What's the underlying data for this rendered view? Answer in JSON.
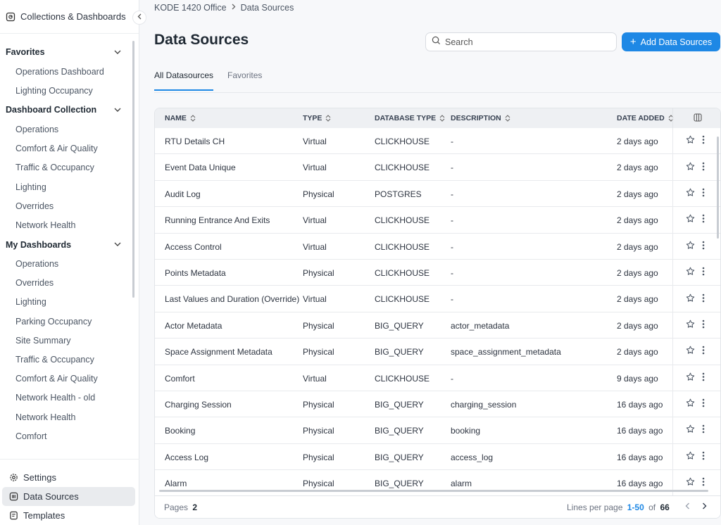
{
  "sidebar": {
    "top_label": "Collections & Dashboards",
    "favorites": {
      "title": "Favorites",
      "items": [
        "Operations Dashboard",
        "Lighting Occupancy"
      ]
    },
    "dashboard_collection": {
      "title": "Dashboard Collection",
      "items": [
        "Operations",
        "Comfort & Air Quality",
        "Traffic & Occupancy",
        "Lighting",
        "Overrides",
        "Network Health"
      ]
    },
    "my_dashboards": {
      "title": "My Dashboards",
      "items": [
        "Operations",
        "Overrides",
        "Lighting",
        "Parking Occupancy",
        "Site Summary",
        "Traffic & Occupancy",
        "Comfort & Air Quality",
        "Network Health - old",
        "Network Health",
        "Comfort"
      ]
    },
    "bottom": {
      "settings": "Settings",
      "data_sources": "Data Sources",
      "templates": "Templates"
    }
  },
  "breadcrumb": {
    "org": "KODE 1420 Office",
    "current": "Data Sources"
  },
  "header": {
    "title": "Data Sources",
    "search_placeholder": "Search",
    "add_label": "Add Data Sources"
  },
  "tabs": [
    "All Datasources",
    "Favorites"
  ],
  "table": {
    "columns": {
      "name": "NAME",
      "type": "TYPE",
      "db_type": "DATABASE TYPE",
      "description": "DESCRIPTION",
      "date_added": "DATE ADDED"
    },
    "rows": [
      {
        "name": "RTU Details CH",
        "type": "Virtual",
        "db": "CLICKHOUSE",
        "desc": "-",
        "date": "2 days ago"
      },
      {
        "name": "Event Data Unique",
        "type": "Virtual",
        "db": "CLICKHOUSE",
        "desc": "-",
        "date": "2 days ago"
      },
      {
        "name": "Audit Log",
        "type": "Physical",
        "db": "POSTGRES",
        "desc": "-",
        "date": "2 days ago"
      },
      {
        "name": "Running Entrance And Exits",
        "type": "Virtual",
        "db": "CLICKHOUSE",
        "desc": "-",
        "date": "2 days ago"
      },
      {
        "name": "Access Control",
        "type": "Virtual",
        "db": "CLICKHOUSE",
        "desc": "-",
        "date": "2 days ago"
      },
      {
        "name": "Points Metadata",
        "type": "Physical",
        "db": "CLICKHOUSE",
        "desc": "-",
        "date": "2 days ago"
      },
      {
        "name": "Last Values and Duration (Override)",
        "type": "Virtual",
        "db": "CLICKHOUSE",
        "desc": "-",
        "date": "2 days ago"
      },
      {
        "name": "Actor Metadata",
        "type": "Physical",
        "db": "BIG_QUERY",
        "desc": "actor_metadata",
        "date": "2 days ago"
      },
      {
        "name": "Space Assignment Metadata",
        "type": "Physical",
        "db": "BIG_QUERY",
        "desc": "space_assignment_metadata",
        "date": "2 days ago"
      },
      {
        "name": "Comfort",
        "type": "Virtual",
        "db": "CLICKHOUSE",
        "desc": "-",
        "date": "9 days ago"
      },
      {
        "name": "Charging Session",
        "type": "Physical",
        "db": "BIG_QUERY",
        "desc": "charging_session",
        "date": "16 days ago"
      },
      {
        "name": "Booking",
        "type": "Physical",
        "db": "BIG_QUERY",
        "desc": "booking",
        "date": "16 days ago"
      },
      {
        "name": "Access Log",
        "type": "Physical",
        "db": "BIG_QUERY",
        "desc": "access_log",
        "date": "16 days ago"
      },
      {
        "name": "Alarm",
        "type": "Physical",
        "db": "BIG_QUERY",
        "desc": "alarm",
        "date": "16 days ago"
      }
    ]
  },
  "footer": {
    "pages_label": "Pages",
    "pages_count": "2",
    "lines_label": "Lines per page",
    "range": "1-50",
    "of_label": "of",
    "total": "66"
  }
}
